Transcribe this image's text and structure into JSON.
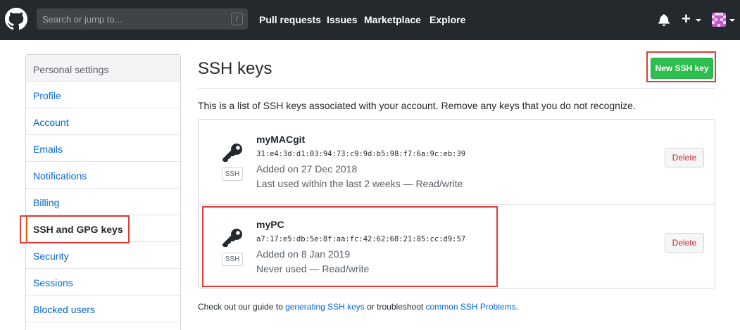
{
  "header": {
    "search_placeholder": "Search or jump to...",
    "search_shortcut": "/",
    "nav": [
      "Pull requests",
      "Issues",
      "Marketplace",
      "Explore"
    ],
    "new_menu_label": "+"
  },
  "sidebar": {
    "heading": "Personal settings",
    "items": [
      {
        "label": "Profile"
      },
      {
        "label": "Account"
      },
      {
        "label": "Emails"
      },
      {
        "label": "Notifications"
      },
      {
        "label": "Billing"
      },
      {
        "label": "SSH and GPG keys",
        "selected": true
      },
      {
        "label": "Security"
      },
      {
        "label": "Sessions"
      },
      {
        "label": "Blocked users"
      }
    ]
  },
  "main": {
    "title": "SSH keys",
    "new_button": "New SSH key",
    "description": "This is a list of SSH keys associated with your account. Remove any keys that you do not recognize.",
    "keys": [
      {
        "name": "myMACgit",
        "fingerprint": "31:e4:3d:d1:03:94:73:c9:9d:b5:98:f7:6a:9c:eb:39",
        "added": "Added on 27 Dec 2018",
        "last_used": "Last used within the last 2 weeks — Read/write",
        "type_label": "SSH",
        "delete_label": "Delete"
      },
      {
        "name": "myPC",
        "fingerprint": "a7:17:e5:db:5e:8f:aa:fc:42:62:68:21:85:cc:d9:57",
        "added": "Added on 8 Jan 2019",
        "last_used": "Never used — Read/write",
        "type_label": "SSH",
        "delete_label": "Delete"
      }
    ],
    "footer": {
      "prefix": "Check out our guide to ",
      "link1": "generating SSH keys",
      "middle": " or troubleshoot ",
      "link2": "common SSH Problems",
      "suffix": "."
    }
  },
  "colors": {
    "header_bg": "#24292e",
    "link": "#0366d6",
    "primary_button": "#2cbe4e",
    "danger_text": "#cb2431",
    "annotation_red": "#e03c3c"
  }
}
